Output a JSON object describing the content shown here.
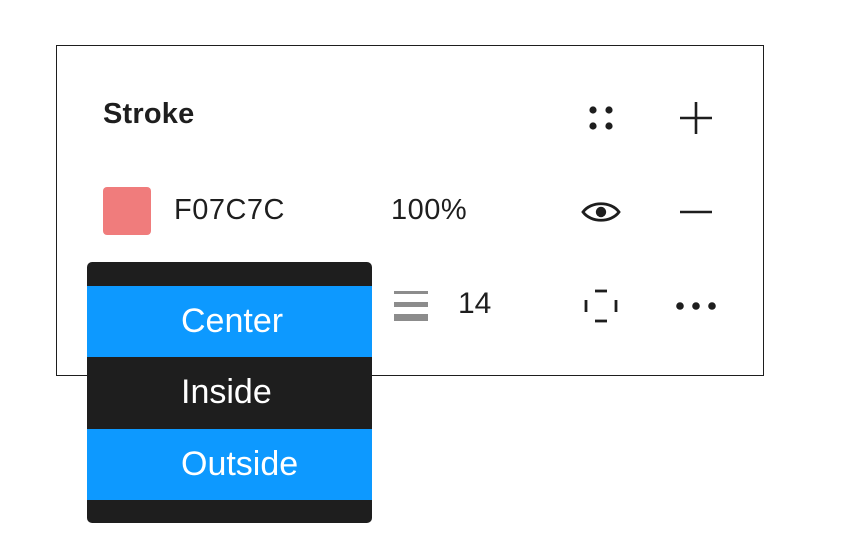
{
  "stroke": {
    "title": "Stroke",
    "color_hex": "F07C7C",
    "color_swatch": "#F07C7C",
    "opacity": "100%",
    "weight": "14",
    "icons": {
      "styles": "styles-grid-icon",
      "add": "plus-icon",
      "visibility": "eye-icon",
      "remove": "minus-icon",
      "stroke_weight": "stroke-weight-icon",
      "individual_strokes": "dashed-square-icon",
      "more": "more-options-icon"
    }
  },
  "position_dropdown": {
    "options": [
      {
        "label": "Center",
        "highlighted": true
      },
      {
        "label": "Inside",
        "highlighted": false
      },
      {
        "label": "Outside",
        "highlighted": true
      }
    ]
  },
  "colors": {
    "accent": "#0D99FF",
    "menu_background": "#1E1E1E",
    "text": "#1E1E1E"
  }
}
